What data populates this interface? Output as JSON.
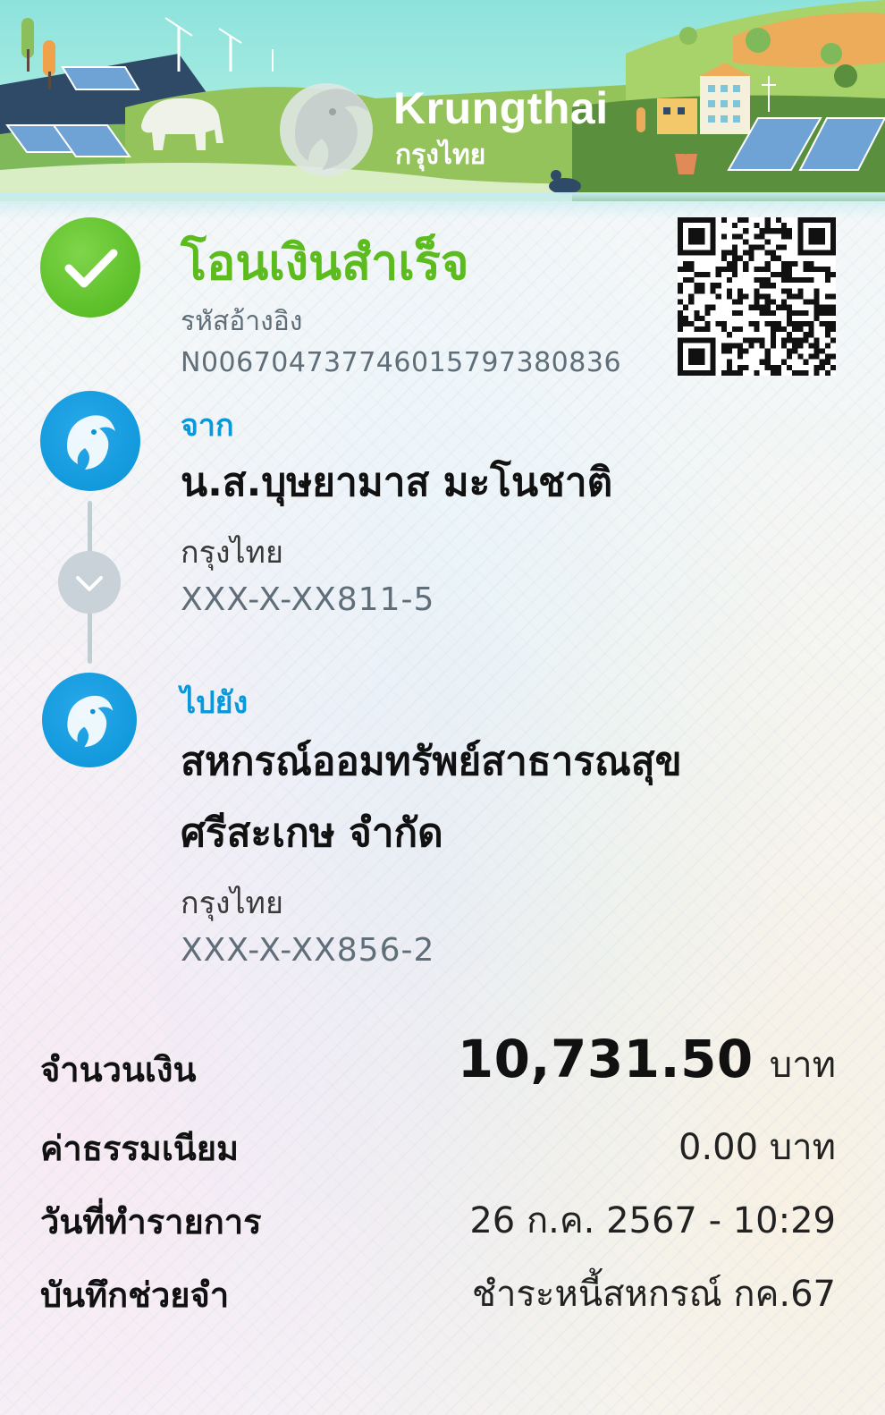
{
  "brand": {
    "name_en": "Krungthai",
    "name_th": "กรุงไทย",
    "colors": {
      "primary": "#0893d6",
      "success": "#5cbc1e",
      "banner": "#8de3dc"
    }
  },
  "status": {
    "title": "โอนเงินสำเร็จ",
    "ref_label": "รหัสอ้างอิง",
    "ref_value": "N006704737746015797380836",
    "icon": "check-icon"
  },
  "from": {
    "label": "จาก",
    "name": "น.ส.บุษยามาส มะโนชาติ",
    "bank": "กรุงไทย",
    "account": "XXX-X-XX811-5"
  },
  "to": {
    "label": "ไปยัง",
    "name": "สหกรณ์ออมทรัพย์สาธารณสุข ศรีสะเกษ จำกัด",
    "bank": "กรุงไทย",
    "account": "XXX-X-XX856-2"
  },
  "details": {
    "amount_label": "จำนวนเงิน",
    "amount_value": "10,731.50",
    "amount_unit": "บาท",
    "fee_label": "ค่าธรรมเนียม",
    "fee_value": "0.00 บาท",
    "date_label": "วันที่ทำรายการ",
    "date_value": "26 ก.ค. 2567 - 10:29",
    "memo_label": "บันทึกช่วยจำ",
    "memo_value": "ชำระหนี้สหกรณ์ กค.67"
  }
}
